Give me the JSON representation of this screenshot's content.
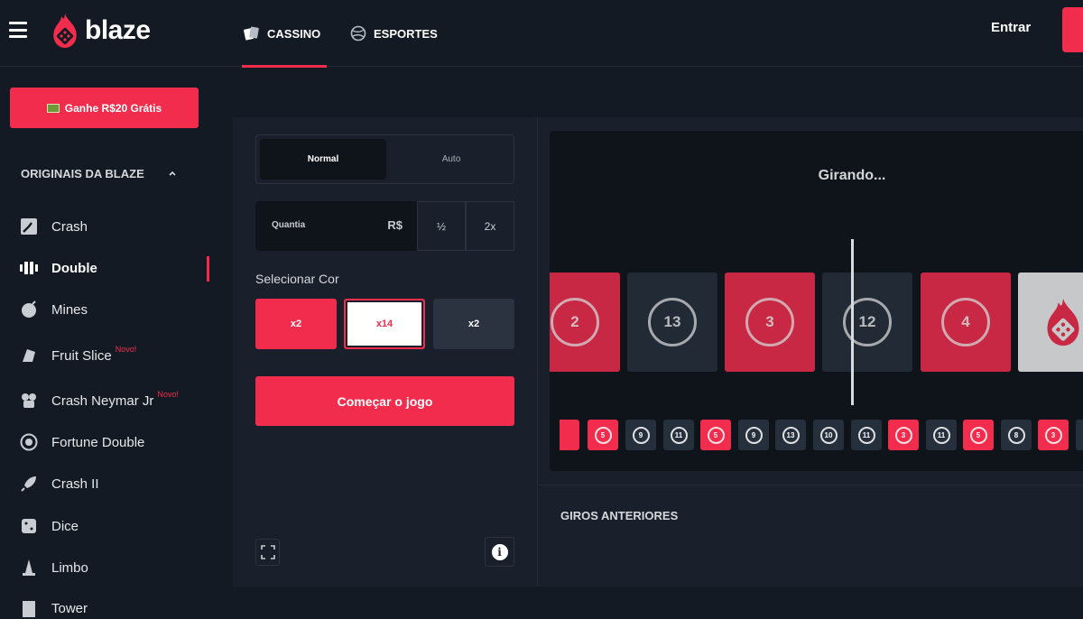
{
  "header": {
    "logo_text": "blaze",
    "tabs": [
      {
        "label": "CASSINO",
        "icon": "cards-icon",
        "active": true
      },
      {
        "label": "ESPORTES",
        "icon": "sports-ball-icon",
        "active": false
      }
    ],
    "login_label": "Entrar",
    "accent_color": "#f12c4c"
  },
  "sidebar": {
    "promo_label": "Ganhe R$20 Grátis",
    "section_title": "ORIGINAIS DA BLAZE",
    "items": [
      {
        "label": "Crash",
        "icon": "crash-icon",
        "badge": ""
      },
      {
        "label": "Double",
        "icon": "double-icon",
        "badge": "",
        "active": true
      },
      {
        "label": "Mines",
        "icon": "mines-icon",
        "badge": ""
      },
      {
        "label": "Fruit Slice",
        "icon": "fruit-slice-icon",
        "badge": "Novo!"
      },
      {
        "label": "Crash Neymar Jr",
        "icon": "neymar-icon",
        "badge": "Novo!"
      },
      {
        "label": "Fortune Double",
        "icon": "fortune-double-icon",
        "badge": ""
      },
      {
        "label": "Crash II",
        "icon": "rocket-icon",
        "badge": ""
      },
      {
        "label": "Dice",
        "icon": "dice-icon",
        "badge": ""
      },
      {
        "label": "Limbo",
        "icon": "limbo-icon",
        "badge": ""
      },
      {
        "label": "Tower",
        "icon": "tower-icon",
        "badge": ""
      }
    ]
  },
  "controls": {
    "mode_normal": "Normal",
    "mode_auto": "Auto",
    "amount_label": "Quantia",
    "currency": "R$",
    "half_label": "½",
    "double_label": "2x",
    "select_color_label": "Selecionar Cor",
    "color_red_label": "x2",
    "color_white_label": "x14",
    "color_black_label": "x2",
    "start_label": "Começar o jogo",
    "info_label": "i"
  },
  "wheel": {
    "status": "Girando...",
    "tiles": [
      {
        "color": "red",
        "number": "2"
      },
      {
        "color": "black",
        "number": "13"
      },
      {
        "color": "red",
        "number": "3"
      },
      {
        "color": "black",
        "number": "12"
      },
      {
        "color": "red",
        "number": "4"
      },
      {
        "color": "white",
        "number": ""
      }
    ]
  },
  "history": {
    "title": "GIROS ANTERIORES",
    "items": [
      {
        "color": "red",
        "number": "5"
      },
      {
        "color": "black",
        "number": "9"
      },
      {
        "color": "black",
        "number": "11"
      },
      {
        "color": "red",
        "number": "5"
      },
      {
        "color": "black",
        "number": "9"
      },
      {
        "color": "black",
        "number": "13"
      },
      {
        "color": "black",
        "number": "10"
      },
      {
        "color": "black",
        "number": "11"
      },
      {
        "color": "red",
        "number": "3"
      },
      {
        "color": "black",
        "number": "11"
      },
      {
        "color": "red",
        "number": "5"
      },
      {
        "color": "black",
        "number": "8"
      },
      {
        "color": "red",
        "number": "3"
      }
    ]
  }
}
